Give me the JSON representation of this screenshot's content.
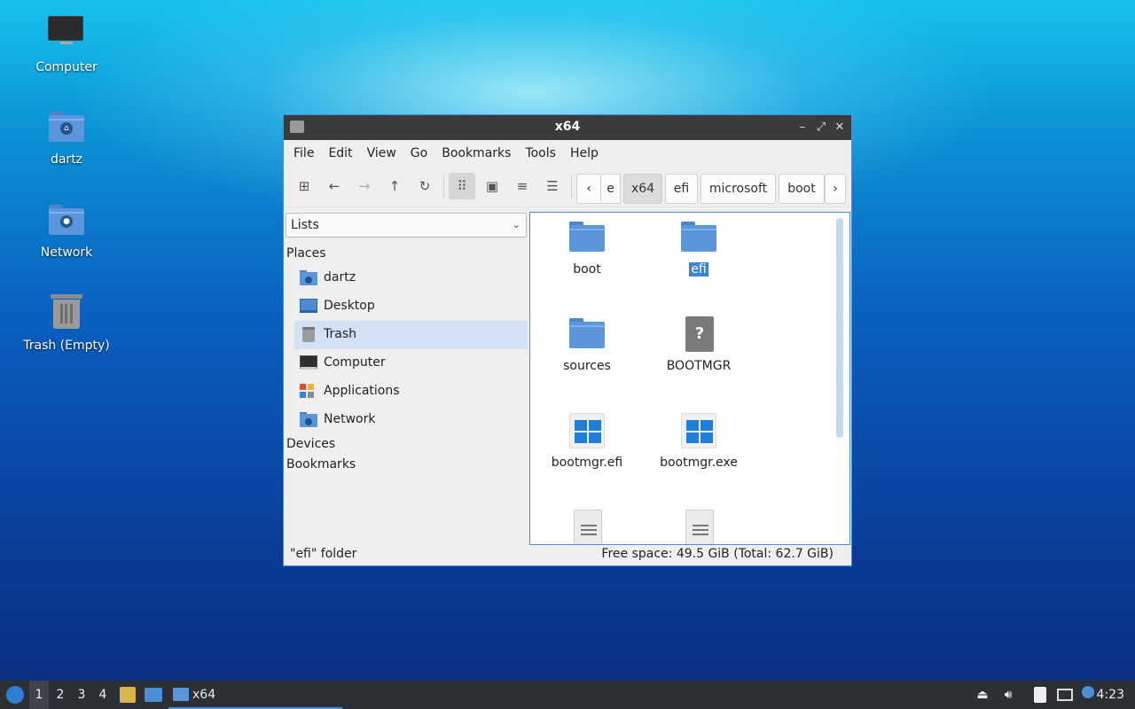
{
  "desktop": {
    "icons": [
      {
        "label": "Computer"
      },
      {
        "label": "dartz"
      },
      {
        "label": "Network"
      },
      {
        "label": "Trash (Empty)"
      }
    ]
  },
  "window": {
    "title": "x64",
    "menu": [
      "File",
      "Edit",
      "View",
      "Go",
      "Bookmarks",
      "Tools",
      "Help"
    ],
    "breadcrumbs": [
      "e",
      "x64",
      "efi",
      "microsoft",
      "boot"
    ],
    "active_crumb": "x64",
    "sidebar": {
      "selector": "Lists",
      "places_header": "Places",
      "places": [
        {
          "label": "dartz",
          "icon": "home-folder-icon"
        },
        {
          "label": "Desktop",
          "icon": "desktop-icon"
        },
        {
          "label": "Trash",
          "icon": "trash-icon",
          "selected": true
        },
        {
          "label": "Computer",
          "icon": "computer-icon"
        },
        {
          "label": "Applications",
          "icon": "applications-icon"
        },
        {
          "label": "Network",
          "icon": "network-folder-icon"
        }
      ],
      "devices_header": "Devices",
      "bookmarks_header": "Bookmarks"
    },
    "files": [
      {
        "name": "boot",
        "type": "folder"
      },
      {
        "name": "efi",
        "type": "folder",
        "selected": true
      },
      {
        "name": "sources",
        "type": "folder"
      },
      {
        "name": "BOOTMGR",
        "type": "unknown"
      },
      {
        "name": "bootmgr.efi",
        "type": "windows-binary"
      },
      {
        "name": "bootmgr.exe",
        "type": "windows-binary"
      },
      {
        "name": "",
        "type": "text"
      },
      {
        "name": "",
        "type": "text"
      }
    ],
    "status": {
      "selection": "\"efi\" folder",
      "free_space": "Free space: 49.5 GiB (Total: 62.7 GiB)"
    }
  },
  "taskbar": {
    "workspaces": [
      "1",
      "2",
      "3",
      "4"
    ],
    "task_label": "x64",
    "clock": "4:23"
  },
  "colors": {
    "accent": "#4d8ad6",
    "folder": "#5b95dc",
    "titlebar": "#3b3b3b",
    "taskbar": "#2c2f34"
  }
}
